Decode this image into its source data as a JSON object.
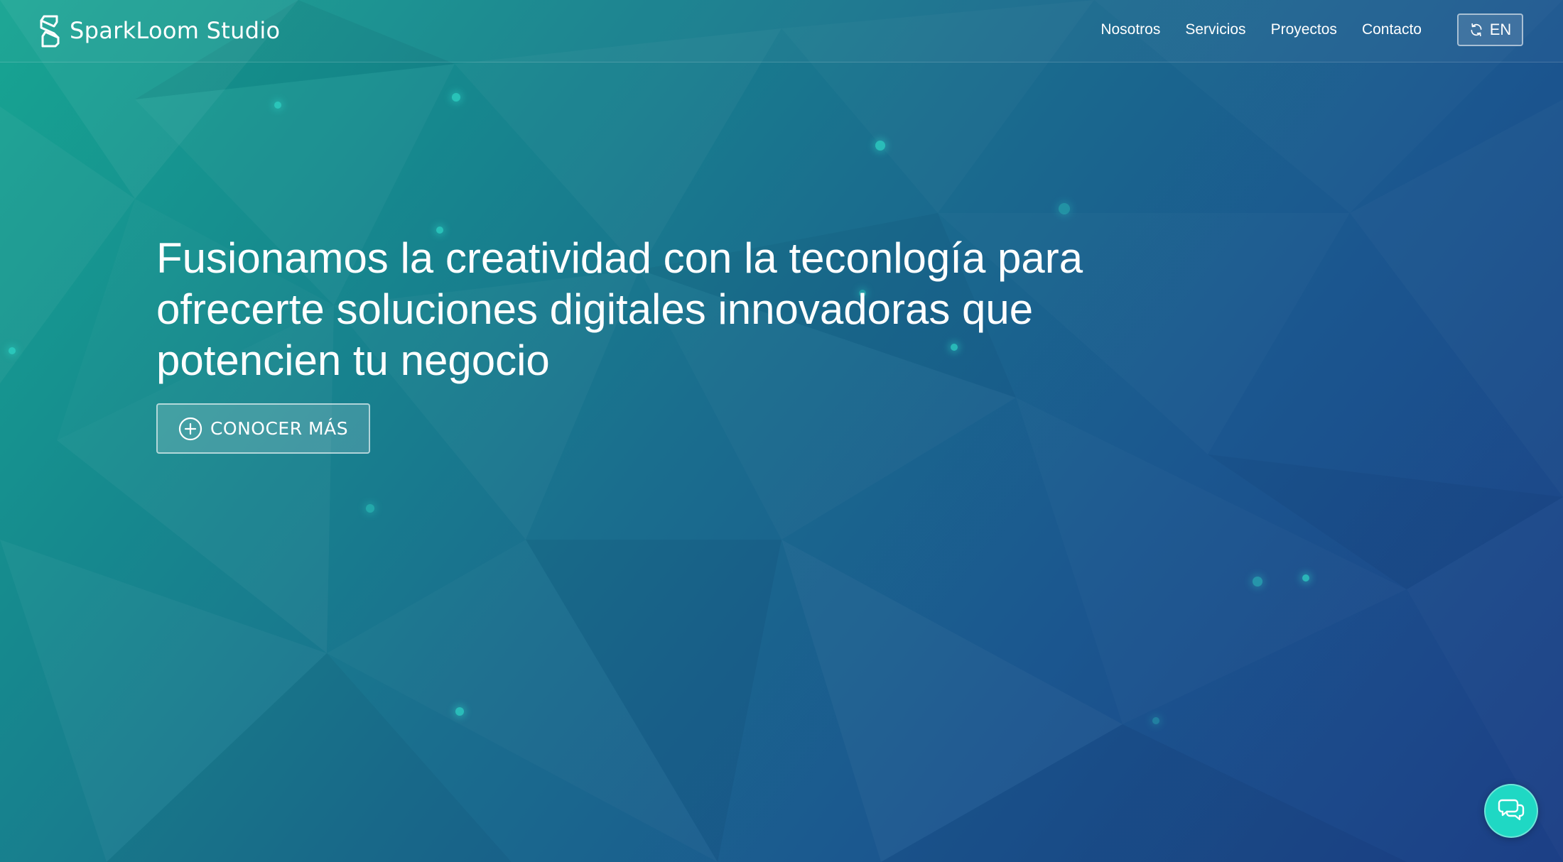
{
  "header": {
    "brand_name": "SparkLoom Studio",
    "nav": [
      {
        "label": "Nosotros"
      },
      {
        "label": "Servicios"
      },
      {
        "label": "Proyectos"
      },
      {
        "label": "Contacto"
      }
    ],
    "language_button": {
      "label": "EN",
      "icon": "refresh-icon"
    }
  },
  "hero": {
    "title": "Fusionamos la creatividad con la teconlogía para ofrecerte soluciones digitales innovadoras que potencien tu negocio",
    "cta": {
      "label": "CONOCER MÁS",
      "icon": "plus-circle-icon"
    }
  },
  "chat": {
    "icon": "chat-bubbles-icon"
  },
  "colors": {
    "gradient_start": "#17a592",
    "gradient_end": "#1c3f86",
    "accent": "#1fd8c4"
  }
}
